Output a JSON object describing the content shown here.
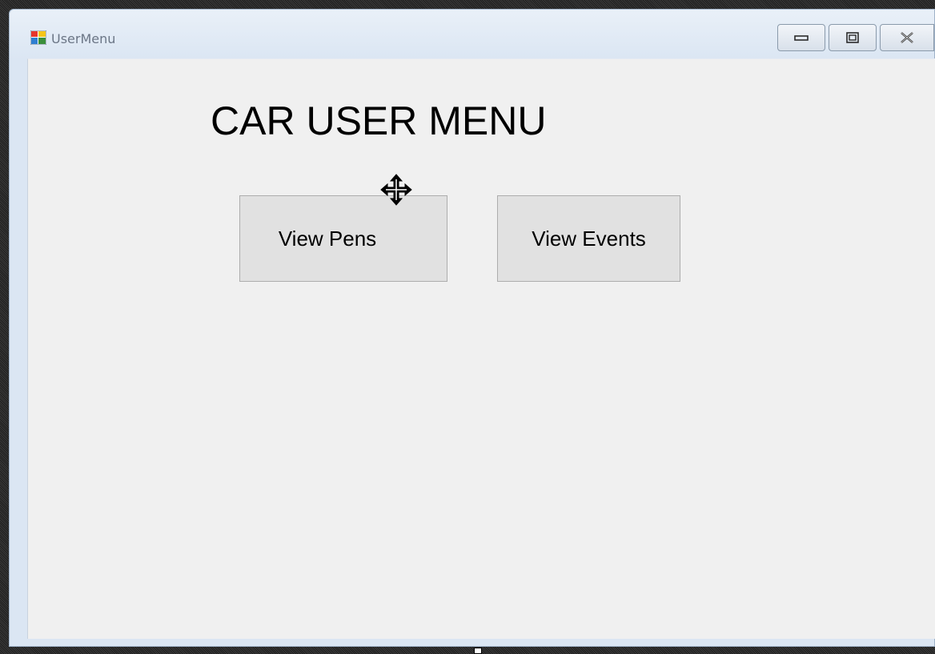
{
  "window": {
    "title": "UserMenu",
    "icon": "form-icon",
    "controls": {
      "minimize_icon": "minimize-icon",
      "maximize_icon": "maximize-icon",
      "close_icon": "close-icon"
    }
  },
  "form": {
    "heading": "CAR USER MENU",
    "buttons": {
      "view_pens": "View Pens",
      "view_events": "View Events"
    }
  },
  "cursor": {
    "icon": "move-cursor-icon"
  },
  "colors": {
    "client_background": "#f0f0f0",
    "button_background": "#e1e1e1",
    "button_border": "#adadad",
    "title_text": "#6b7686"
  }
}
